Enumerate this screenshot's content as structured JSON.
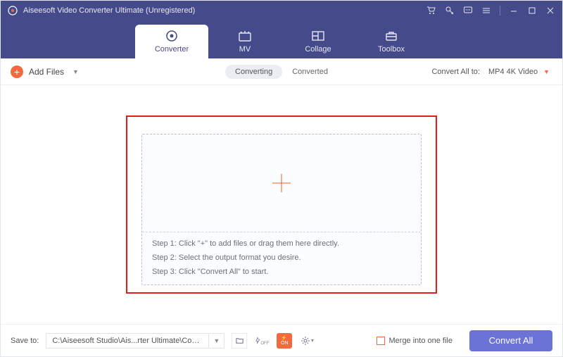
{
  "app": {
    "title": "Aiseesoft Video Converter Ultimate (Unregistered)"
  },
  "nav": {
    "tabs": [
      {
        "label": "Converter"
      },
      {
        "label": "MV"
      },
      {
        "label": "Collage"
      },
      {
        "label": "Toolbox"
      }
    ]
  },
  "toolbar": {
    "add_files": "Add Files",
    "seg": {
      "converting": "Converting",
      "converted": "Converted"
    },
    "convert_all_to_label": "Convert All to:",
    "format_selected": "MP4 4K Video"
  },
  "dropzone": {
    "step1": "Step 1: Click \"+\" to add files or drag them here directly.",
    "step2": "Step 2: Select the output format you desire.",
    "step3": "Step 3: Click \"Convert All\" to start."
  },
  "bottombar": {
    "save_to_label": "Save to:",
    "path": "C:\\Aiseesoft Studio\\Ais...rter Ultimate\\Converted",
    "merge_label": "Merge into one file",
    "convert_all": "Convert All"
  }
}
